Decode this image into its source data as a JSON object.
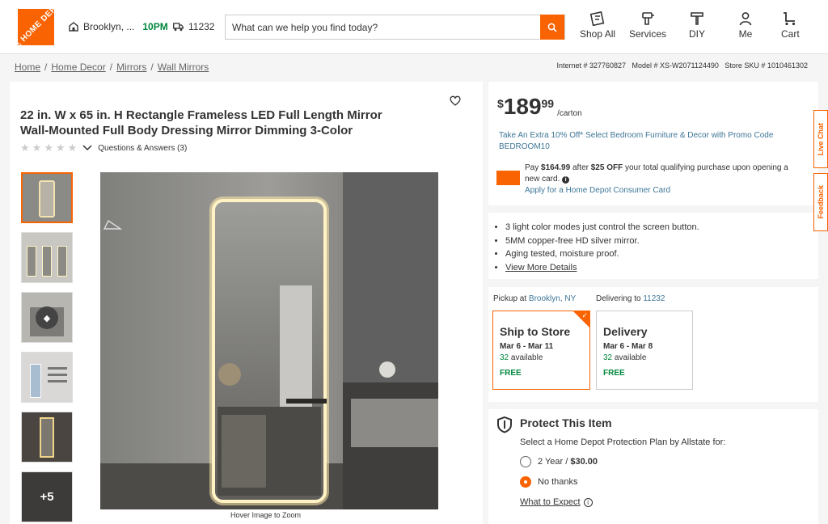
{
  "header": {
    "logo_text": "THE HOME DEPOT",
    "store": "Brooklyn, ...",
    "store_time": "10PM",
    "zip": "11232",
    "search_placeholder": "What can we help you find today?",
    "nav": [
      "Shop All",
      "Services",
      "DIY",
      "Me",
      "Cart"
    ]
  },
  "breadcrumb": [
    "Home",
    "Home Decor",
    "Mirrors",
    "Wall Mirrors"
  ],
  "ids": "Internet # 327760827   Model # XS-W2071124490   Store SKU # 1010461302",
  "product": {
    "title": "22 in. W x 65 in. H Rectangle Frameless LED Full Length Mirror Wall-Mounted Full Body Dressing Mirror Dimming 3-Color",
    "qa": "Questions & Answers (3)",
    "thumb_more": "+5",
    "zoom_hint": "Hover Image to Zoom"
  },
  "price": {
    "dollar": "$",
    "whole": "189",
    "cents": "99",
    "unit": "/carton",
    "promo": "Take An Extra 10% Off* Select Bedroom Furniture & Decor with Promo Code BEDROOM10",
    "credit_pre": "Pay ",
    "credit_amount": "$164.99",
    "credit_mid": " after ",
    "credit_off": "$25 OFF",
    "credit_post": " your total qualifying purchase upon opening a new card.",
    "apply": "Apply for a Home Depot Consumer Card"
  },
  "bullets": [
    "3 light color modes just control the screen button.",
    "5MM copper-free HD silver mirror.",
    "Aging tested, moisture proof."
  ],
  "view_more": "View More Details",
  "fulfillment": {
    "pickup_label": "Pickup at ",
    "pickup_store": "Brooklyn, NY",
    "deliver_label": "Delivering to ",
    "deliver_zip": "11232",
    "ship": {
      "title": "Ship to Store",
      "dates": "Mar 6 - Mar 11",
      "count": "32",
      "avail": " available",
      "cost": "FREE"
    },
    "delivery": {
      "title": "Delivery",
      "dates": "Mar 6 - Mar 8",
      "count": "32",
      "avail": " available",
      "cost": "FREE"
    }
  },
  "protection": {
    "title": "Protect This Item",
    "subtitle": "Select a Home Depot Protection Plan by Allstate for:",
    "opt1_years": "2 Year / ",
    "opt1_price": "$30.00",
    "opt2": "No thanks",
    "link": "What to Expect"
  },
  "side_tabs": [
    "Live Chat",
    "Feedback"
  ],
  "colors": {
    "brand": "#f96302",
    "link": "#3e7697",
    "green": "#00873c"
  }
}
